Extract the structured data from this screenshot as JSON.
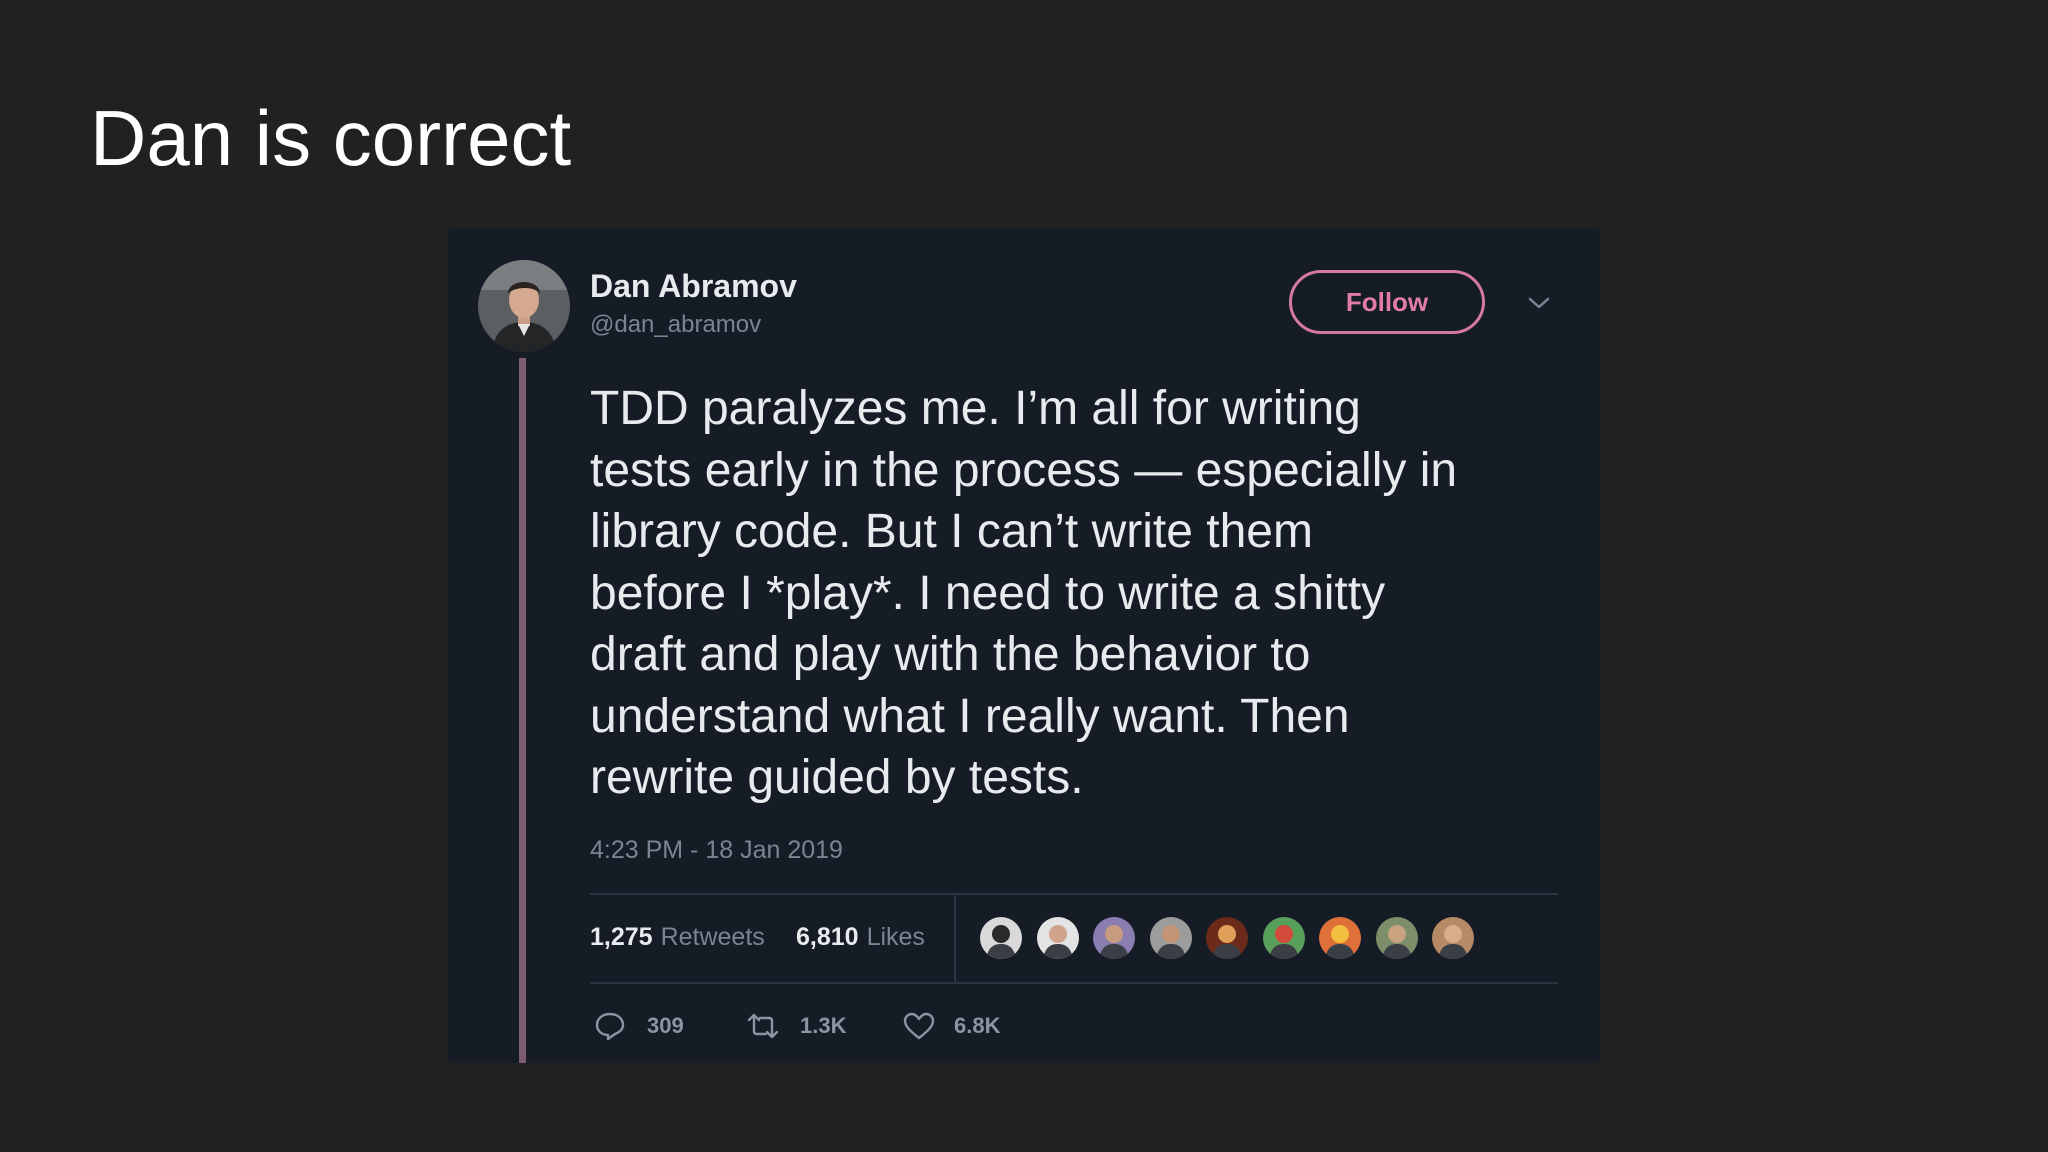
{
  "slide": {
    "title": "Dan is correct"
  },
  "tweet": {
    "author": {
      "name": "Dan Abramov",
      "handle": "@dan_abramov",
      "avatar_icon": "profile-photo"
    },
    "follow_label": "Follow",
    "menu_icon": "chevron-down-icon",
    "text_lines": [
      "TDD paralyzes me. I’m all for writing",
      "tests early in the process — especially in",
      "library code. But I can’t write them",
      "before I *play*. I need to write a shitty",
      "draft and play with the behavior to",
      "understand what I really want. Then",
      "rewrite guided by tests."
    ],
    "timestamp": "4:23 PM - 18 Jan 2019",
    "stats": {
      "retweets_count": "1,275",
      "retweets_label": "Retweets",
      "likes_count": "6,810",
      "likes_label": "Likes"
    },
    "liker_avatars_count": 9,
    "actions": {
      "reply_count": "309",
      "retweet_count": "1.3K",
      "like_count": "6.8K"
    }
  },
  "colors": {
    "slide_background": "#212121",
    "card_background": "#161c26",
    "accent_pink": "#e07ca6",
    "thread_line": "#7e5d70",
    "primary_text": "#e8ebee",
    "secondary_text": "#7a8591"
  }
}
